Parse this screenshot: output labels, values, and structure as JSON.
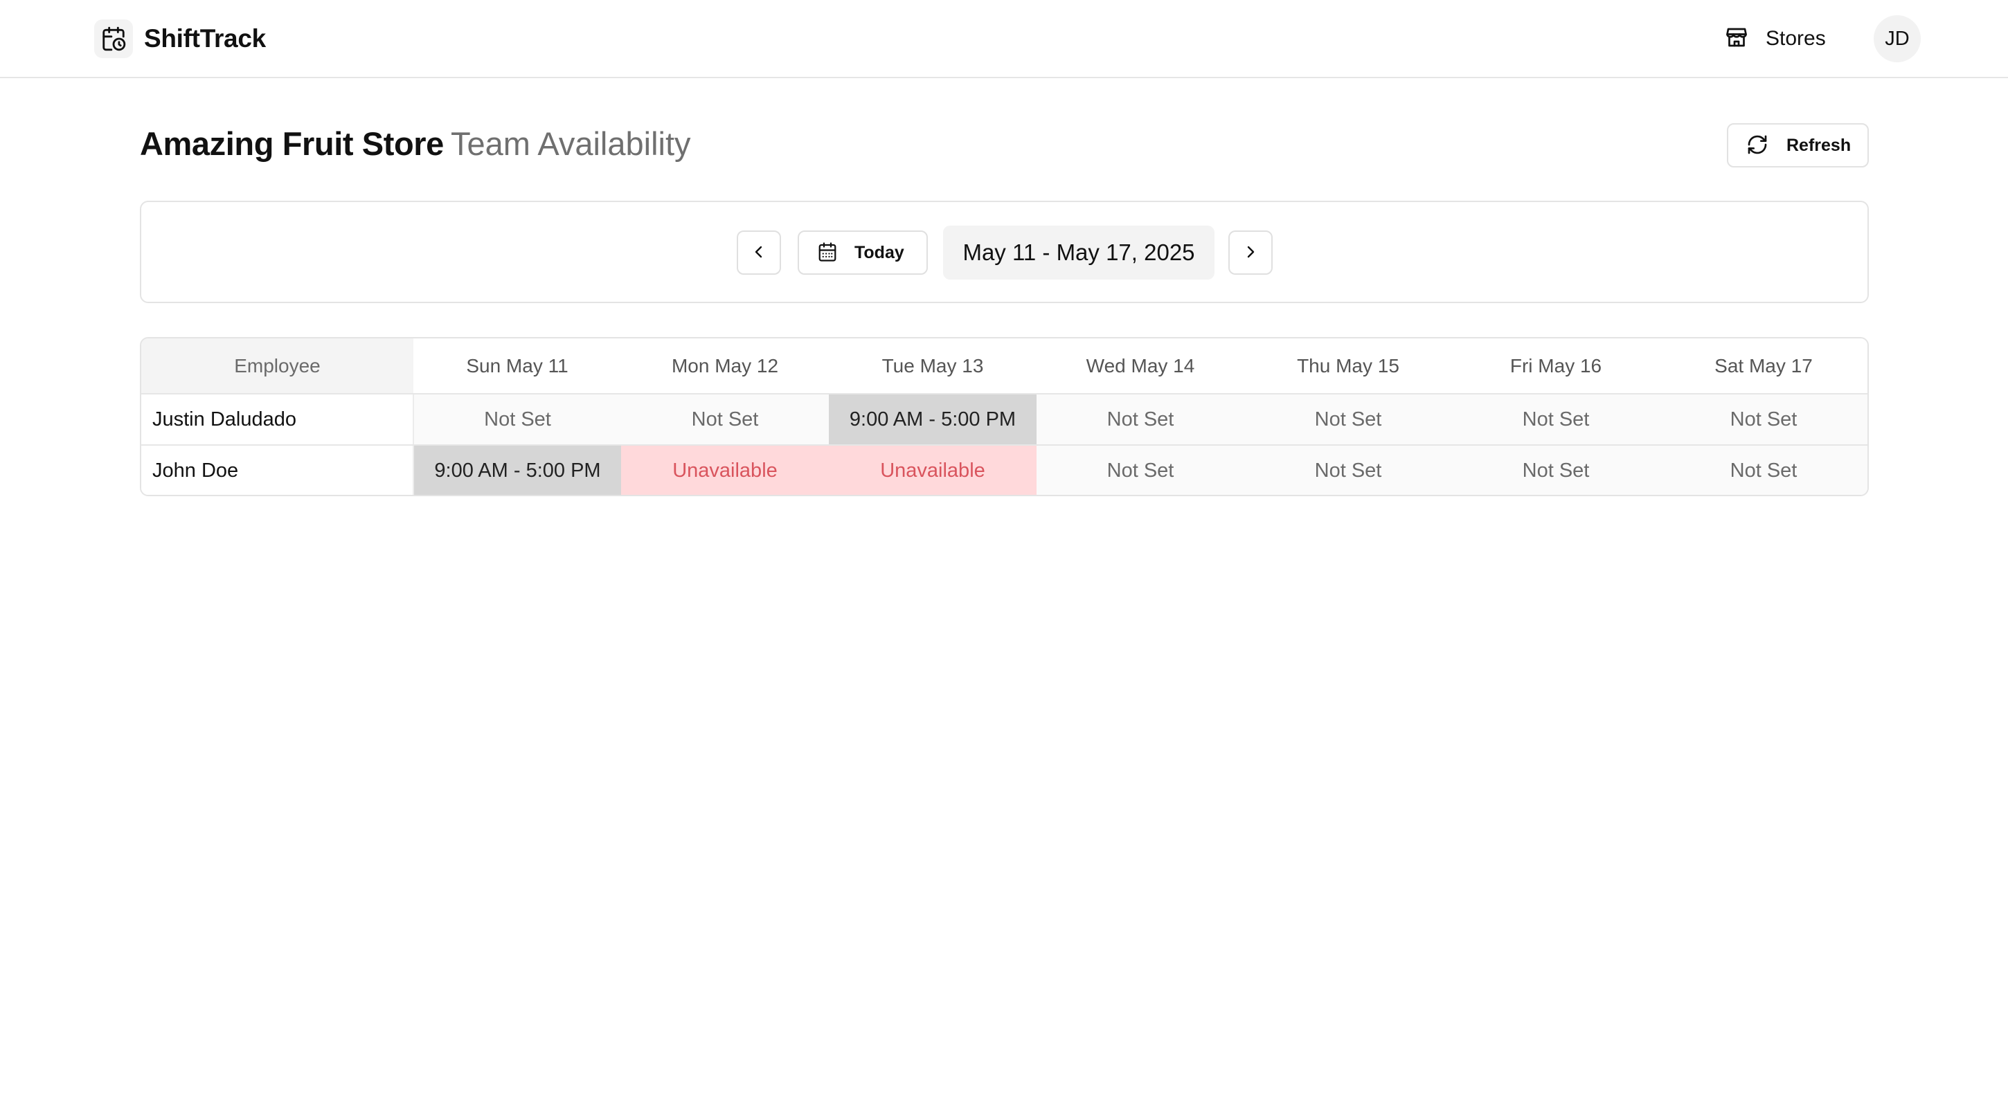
{
  "header": {
    "app_name": "ShiftTrack",
    "stores_label": "Stores",
    "user_initials": "JD"
  },
  "page": {
    "store_name": "Amazing Fruit Store",
    "subtitle": "Team Availability",
    "refresh_label": "Refresh"
  },
  "week_nav": {
    "today_label": "Today",
    "date_range": "May 11 - May 17, 2025"
  },
  "table": {
    "employee_header": "Employee",
    "days": [
      "Sun May 11",
      "Mon May 12",
      "Tue May 13",
      "Wed May 14",
      "Thu May 15",
      "Fri May 16",
      "Sat May 17"
    ],
    "rows": [
      {
        "name": "Justin Daludado",
        "cells": [
          "Not Set",
          "Not Set",
          "9:00 AM - 5:00 PM",
          "Not Set",
          "Not Set",
          "Not Set",
          "Not Set"
        ]
      },
      {
        "name": "John Doe",
        "cells": [
          "9:00 AM - 5:00 PM",
          "Unavailable",
          "Unavailable",
          "Not Set",
          "Not Set",
          "Not Set",
          "Not Set"
        ]
      }
    ]
  },
  "colors": {
    "available_bg": "#d6d6d6",
    "unavailable_bg": "#ffd9db",
    "unavailable_text": "#d9545d"
  },
  "icons": {
    "brand": "calendar-clock-icon",
    "stores": "store-icon",
    "refresh": "refresh-icon",
    "prev": "chevron-left-icon",
    "next": "chevron-right-icon",
    "today": "calendar-icon"
  }
}
